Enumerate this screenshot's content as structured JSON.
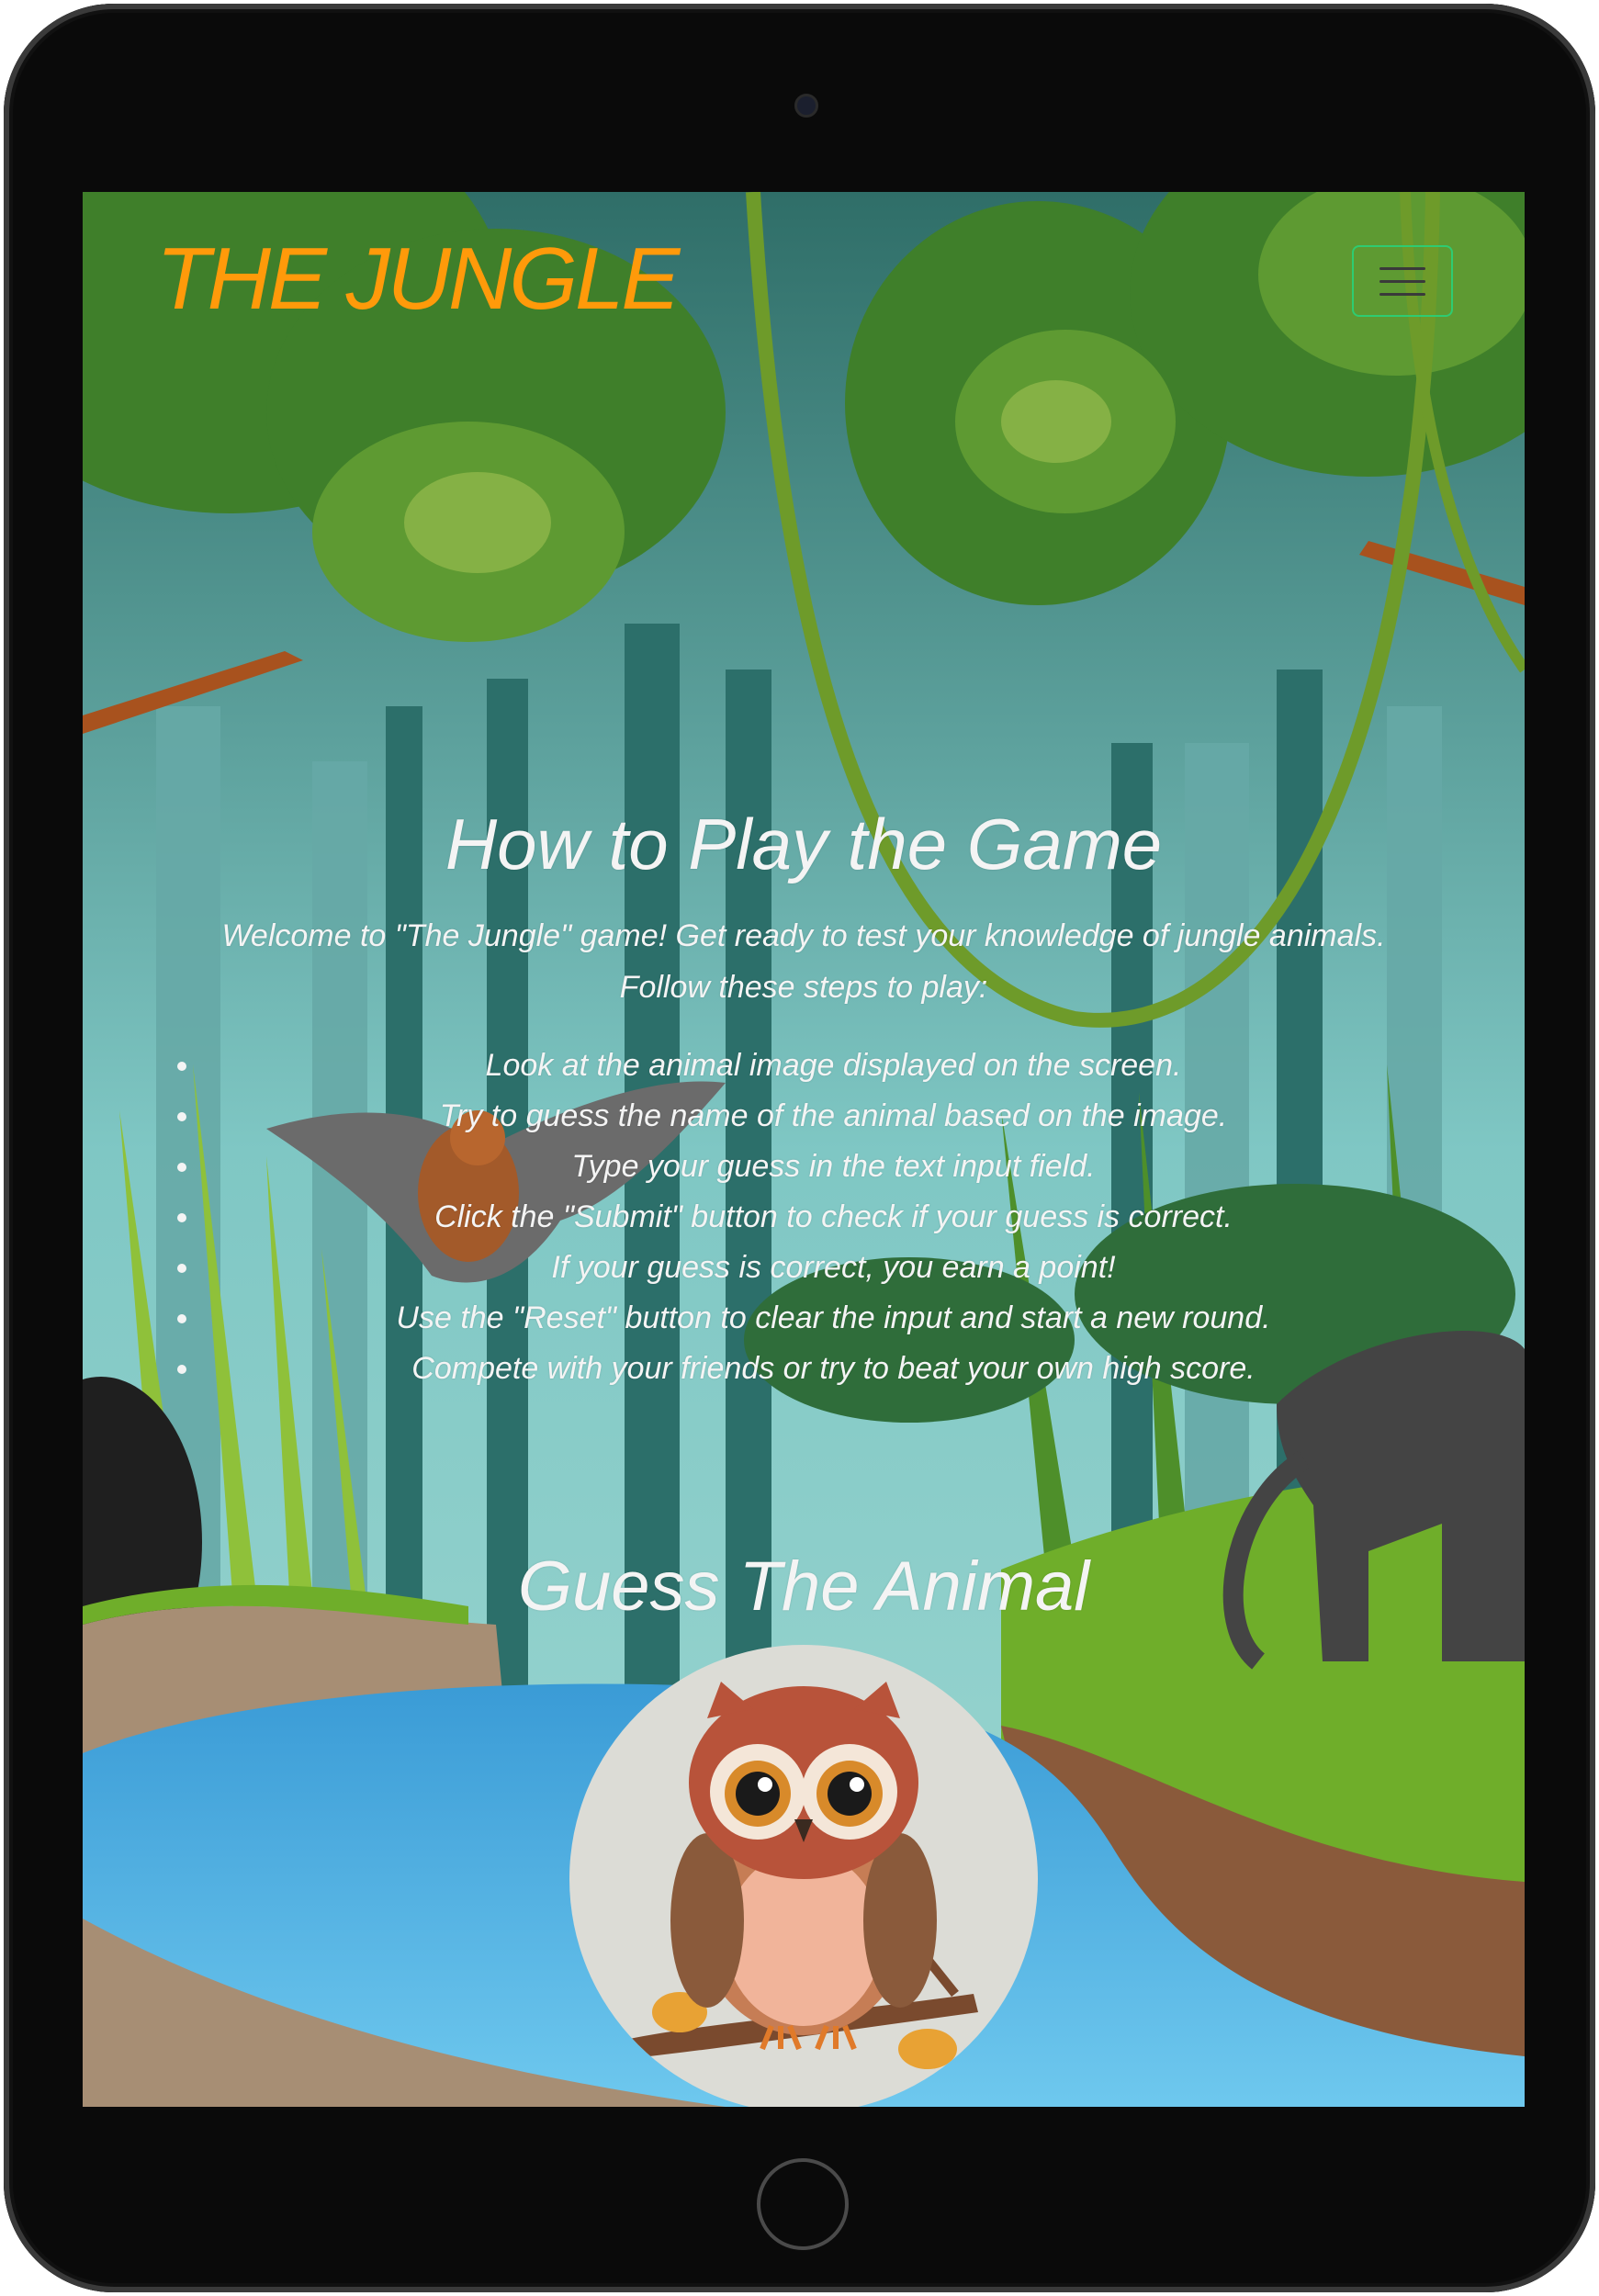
{
  "header": {
    "logo": "THE JUNGLE"
  },
  "how_to_play": {
    "title": "How to Play the Game",
    "intro": "Welcome to \"The Jungle\" game! Get ready to test your knowledge of jungle animals. Follow these steps to play:",
    "steps": [
      "Look at the animal image displayed on the screen.",
      "Try to guess the name of the animal based on the image.",
      "Type your guess in the text input field.",
      "Click the \"Submit\" button to check if your guess is correct.",
      "If your guess is correct, you earn a point!",
      "Use the \"Reset\" button to clear the input and start a new round.",
      "Compete with your friends or try to beat your own high score."
    ]
  },
  "game": {
    "title": "Guess The Animal",
    "image_subject": "owl"
  },
  "colors": {
    "logo": "#ff9a0a",
    "menu_border": "#2ecc71",
    "text": "#f4f4f4"
  },
  "icons": {
    "menu": "hamburger-icon"
  }
}
